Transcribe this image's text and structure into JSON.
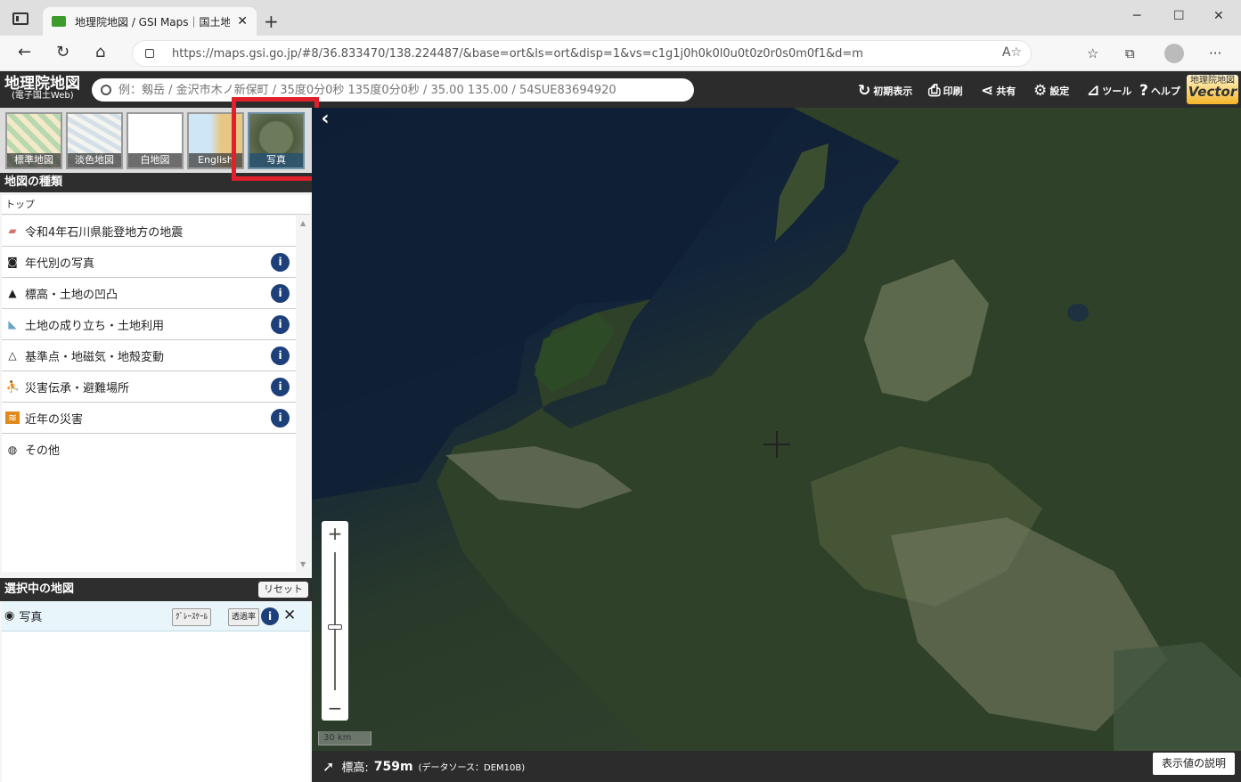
{
  "browser": {
    "tab_title": "地理院地図 / GSI Maps｜国土地",
    "tab_close": "✕",
    "new_tab": "+",
    "url": "https://maps.gsi.go.jp/#8/36.833470/138.224487/&base=ort&ls=ort&disp=1&vs=c1g1j0h0k0l0u0t0z0r0s0m0f1&d=m",
    "url_tools": "A⁰"
  },
  "header": {
    "logo_line1": "地理院地図",
    "logo_line2": "(電子国土Web)",
    "search_placeholder": "例：剱岳 / 金沢市木ノ新保町 / 35度0分0秒 135度0分0秒 / 35.00 135.00 / 54SUE83694920",
    "buttons": {
      "reset": "初期表示",
      "print": "印刷",
      "share": "共有",
      "settings": "設定",
      "tools": "ツール",
      "help": "ヘルプ"
    },
    "vector_line1": "地理院地図",
    "vector_line2": "Vector"
  },
  "basemaps": [
    {
      "label": "標準地図"
    },
    {
      "label": "淡色地図"
    },
    {
      "label": "白地図"
    },
    {
      "label": "English"
    },
    {
      "label": "写真"
    }
  ],
  "sidebar": {
    "section_title": "地図の種類",
    "breadcrumb": "トップ",
    "items": [
      {
        "label": "令和4年石川県能登地方の地震"
      },
      {
        "label": "年代別の写真"
      },
      {
        "label": "標高・土地の凹凸"
      },
      {
        "label": "土地の成り立ち・土地利用"
      },
      {
        "label": "基準点・地磁気・地殻変動"
      },
      {
        "label": "災害伝承・避難場所"
      },
      {
        "label": "近年の災害"
      },
      {
        "label": "その他"
      }
    ],
    "info_glyph": "i"
  },
  "selected": {
    "title": "選択中の地図",
    "reset_label": "リセット",
    "layer_name": "写真",
    "grayscale_label": "ｸﾞﾚｰｽｹｰﾙ",
    "opacity_label": "透過率"
  },
  "map": {
    "scale_label": "30 km",
    "zoom_in": "+",
    "zoom_out": "−",
    "collapse": "‹"
  },
  "footer": {
    "elevation_label": "標高:",
    "elevation_value": "759m",
    "source": "(データソース：DEM10B)",
    "explain_button": "表示値の説明"
  },
  "colors": {
    "header_bg": "#2c2c2c",
    "info_badge": "#1d3f7a",
    "highlight_box": "#e0202a"
  }
}
